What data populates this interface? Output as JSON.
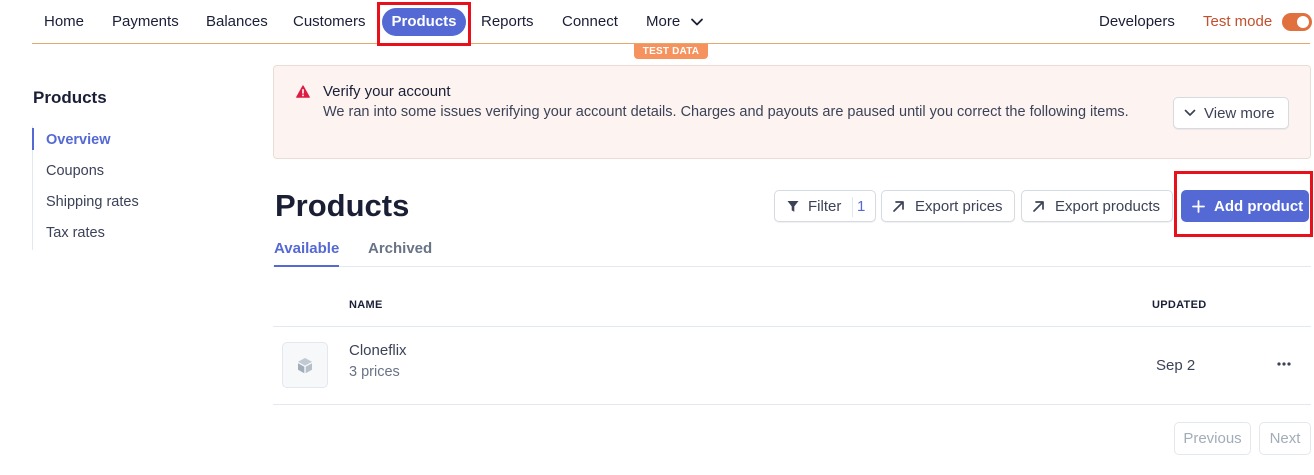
{
  "nav": {
    "items": [
      "Home",
      "Payments",
      "Balances",
      "Customers",
      "Products",
      "Reports",
      "Connect",
      "More"
    ],
    "right_link": "Developers",
    "test_mode_label": "Test mode",
    "test_data_badge": "TEST DATA"
  },
  "sidebar": {
    "title": "Products",
    "items": [
      {
        "label": "Overview",
        "active": true
      },
      {
        "label": "Coupons",
        "active": false
      },
      {
        "label": "Shipping rates",
        "active": false
      },
      {
        "label": "Tax rates",
        "active": false
      }
    ]
  },
  "alert": {
    "title": "Verify your account",
    "body": "We ran into some issues verifying your account details. Charges and payouts are paused until you correct the following items.",
    "button": "View more"
  },
  "page": {
    "title": "Products",
    "filter_label": "Filter",
    "filter_count": "1",
    "export_prices": "Export prices",
    "export_products": "Export products",
    "add_product": "Add product"
  },
  "tabs": [
    {
      "label": "Available",
      "active": true
    },
    {
      "label": "Archived",
      "active": false
    }
  ],
  "table": {
    "columns": [
      "NAME",
      "UPDATED"
    ],
    "rows": [
      {
        "name": "Cloneflix",
        "subtitle": "3 prices",
        "updated": "Sep 2"
      }
    ]
  },
  "pagination": {
    "previous": "Previous",
    "next": "Next"
  },
  "colors": {
    "accent": "#5469d4",
    "test_mode": "#e0703e",
    "highlight_box": "#e8101b",
    "alert_background": "#fdf4f1",
    "alert_icon": "#df1b41"
  },
  "icons": [
    "chevron-down-icon",
    "warning-icon",
    "filter-icon",
    "arrow-up-right-icon",
    "plus-icon",
    "product-box-icon",
    "more-horizontal-icon"
  ]
}
